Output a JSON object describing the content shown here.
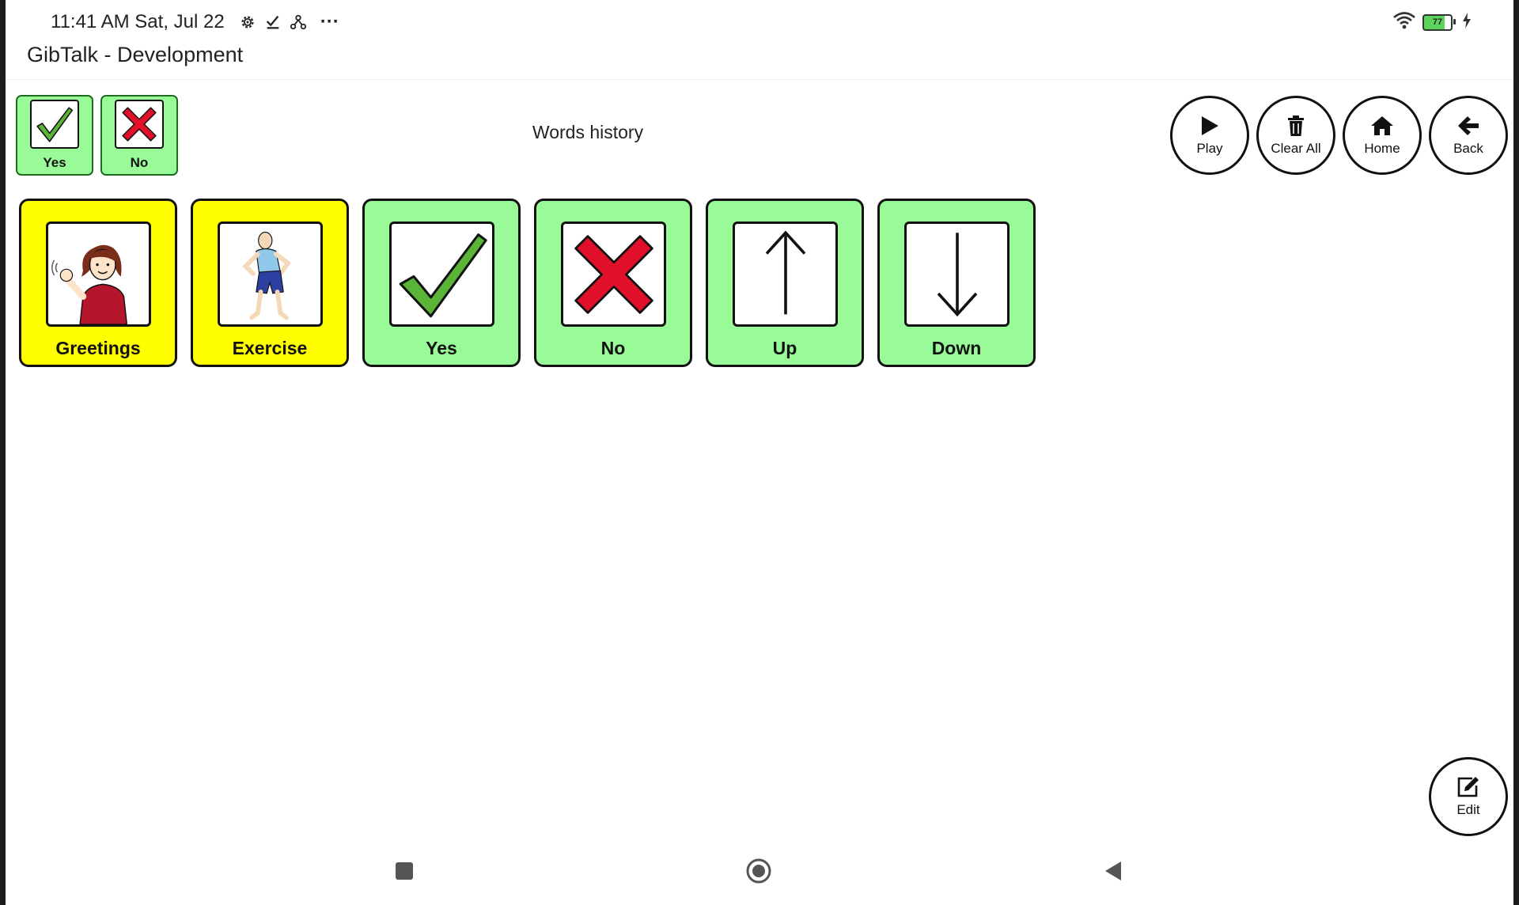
{
  "status_bar": {
    "time": "11:41 AM Sat, Jul 22",
    "icons": [
      "settings-gear-icon",
      "check-icon",
      "share-nodes-icon",
      "more-dots-icon"
    ],
    "more": "···",
    "battery_level": "77",
    "right_icons": [
      "wifi-icon",
      "battery-icon",
      "charging-bolt-icon"
    ]
  },
  "app": {
    "title": "GibTalk - Development"
  },
  "history": {
    "title": "Words history",
    "items": [
      {
        "label": "Yes",
        "icon": "checkmark-icon"
      },
      {
        "label": "No",
        "icon": "red-x-icon"
      }
    ]
  },
  "controls": {
    "play": "Play",
    "clear_all": "Clear All",
    "home": "Home",
    "back": "Back",
    "edit": "Edit"
  },
  "tiles": [
    {
      "label": "Greetings",
      "color": "#ffff00",
      "icon": "waving-person-icon"
    },
    {
      "label": "Exercise",
      "color": "#ffff00",
      "icon": "exercising-person-icon"
    },
    {
      "label": "Yes",
      "color": "#98fb98",
      "icon": "checkmark-icon"
    },
    {
      "label": "No",
      "color": "#98fb98",
      "icon": "red-x-icon"
    },
    {
      "label": "Up",
      "color": "#98fb98",
      "icon": "arrow-up-icon"
    },
    {
      "label": "Down",
      "color": "#98fb98",
      "icon": "arrow-down-icon"
    }
  ],
  "colors": {
    "category_tile": "#ffff00",
    "word_tile": "#98fb98",
    "check": "#5ab437",
    "cross": "#e0102a"
  },
  "nav_bar": [
    "recents-square-icon",
    "home-circle-icon",
    "back-triangle-icon"
  ]
}
